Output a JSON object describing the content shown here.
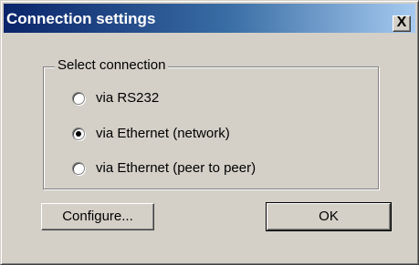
{
  "window": {
    "title": "Connection settings",
    "close_label": "X"
  },
  "group": {
    "legend": "Select connection",
    "options": [
      {
        "label": "via RS232",
        "selected": false
      },
      {
        "label": "via Ethernet (network)",
        "selected": true
      },
      {
        "label": "via Ethernet (peer to peer)",
        "selected": false
      }
    ]
  },
  "buttons": {
    "configure_label": "Configure...",
    "ok_label": "OK"
  }
}
